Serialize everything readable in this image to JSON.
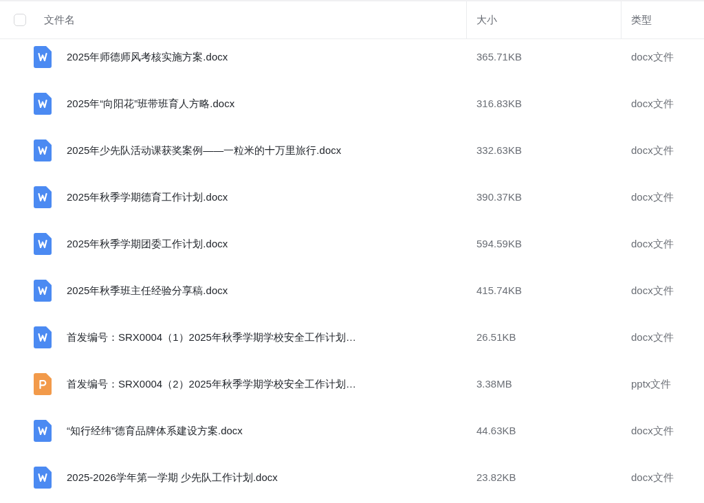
{
  "table": {
    "select_all": {
      "checked": false
    },
    "columns": [
      "文件名",
      "大小",
      "类型"
    ],
    "rows": [
      {
        "kind": "word",
        "name": "2025年师德师风考核实施方案.docx",
        "size": "365.71KB",
        "type": "docx文件"
      },
      {
        "kind": "word",
        "name": "2025年“向阳花”班带班育人方略.docx",
        "size": "316.83KB",
        "type": "docx文件"
      },
      {
        "kind": "word",
        "name": "2025年少先队活动课获奖案例——一粒米的十万里旅行.docx",
        "size": "332.63KB",
        "type": "docx文件"
      },
      {
        "kind": "word",
        "name": "2025年秋季学期德育工作计划.docx",
        "size": "390.37KB",
        "type": "docx文件"
      },
      {
        "kind": "word",
        "name": "2025年秋季学期团委工作计划.docx",
        "size": "594.59KB",
        "type": "docx文件"
      },
      {
        "kind": "word",
        "name": "2025年秋季班主任经验分享稿.docx",
        "size": "415.74KB",
        "type": "docx文件"
      },
      {
        "kind": "word",
        "name": "首发编号：SRX0004（1）2025年秋季学期学校安全工作计划…",
        "size": "26.51KB",
        "type": "docx文件"
      },
      {
        "kind": "slides",
        "name": "首发编号：SRX0004（2）2025年秋季学期学校安全工作计划…",
        "size": "3.38MB",
        "type": "pptx文件"
      },
      {
        "kind": "word",
        "name": "“知行经纬”德育品牌体系建设方案.docx",
        "size": "44.63KB",
        "type": "docx文件"
      },
      {
        "kind": "word",
        "name": "2025-2026学年第一学期 少先队工作计划.docx",
        "size": "23.82KB",
        "type": "docx文件"
      }
    ]
  }
}
